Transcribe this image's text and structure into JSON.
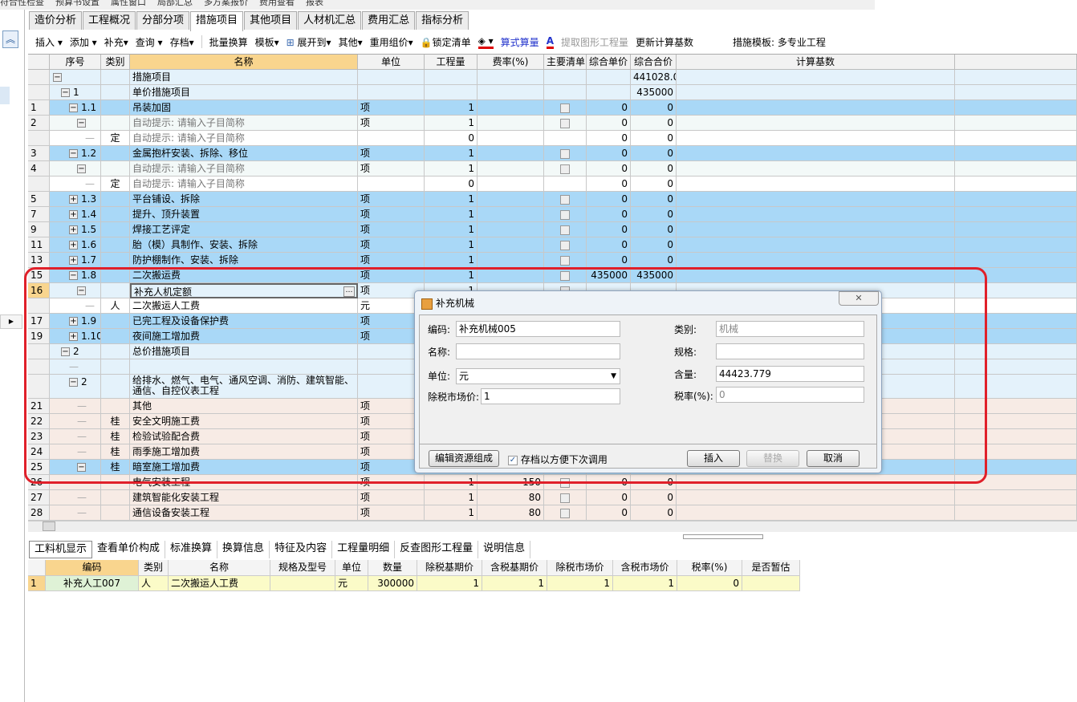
{
  "toolbar_top": [
    "符合性检查",
    "预算书设置",
    "属性窗口",
    "局部汇总",
    "多方案报价",
    "费用查看",
    "报表"
  ],
  "tabs": [
    "造价分析",
    "工程概况",
    "分部分项",
    "措施项目",
    "其他项目",
    "人材机汇总",
    "费用汇总",
    "指标分析"
  ],
  "active_tab": "措施项目",
  "toolbar": {
    "insert": "插入 ▾",
    "add": "添加 ▾",
    "supplement": "补充▾",
    "query": "查询 ▾",
    "archive": "存档▾",
    "batch": "批量换算",
    "template": "模板▾",
    "expand": "展开到▾",
    "other": "其他▾",
    "reuse": "重用组价▾",
    "lock": "锁定清单",
    "formula": "算式算量",
    "extract": "提取图形工程量",
    "update": "更新计算基数",
    "measure_template": "措施模板: 多专业工程"
  },
  "grid": {
    "headers": [
      "",
      "序号",
      "类别",
      "名称",
      "单位",
      "工程量",
      "费率(%)",
      "主要清单",
      "综合单价",
      "综合合价",
      "计算基数",
      ""
    ],
    "rows": [
      {
        "n": "",
        "seq": "措施",
        "t": "",
        "name": "措施项目",
        "unit": "",
        "qty": "",
        "rate": "",
        "main": false,
        "up": "",
        "tp": "441028.09",
        "style": "light",
        "tog": "−",
        "lvl": 0
      },
      {
        "n": "",
        "seq": "1",
        "t": "",
        "name": "单价措施项目",
        "unit": "",
        "qty": "",
        "rate": "",
        "main": false,
        "up": "",
        "tp": "435000",
        "style": "light",
        "tog": "−",
        "lvl": 1
      },
      {
        "n": "1",
        "seq": "1.1",
        "t": "",
        "name": "吊装加固",
        "unit": "项",
        "qty": "1",
        "rate": "",
        "main": true,
        "up": "0",
        "tp": "0",
        "style": "blue",
        "tog": "−",
        "lvl": 2
      },
      {
        "n": "2",
        "seq": "",
        "t": "",
        "name": "自动提示: 请输入子目简称",
        "unit": "项",
        "qty": "1",
        "rate": "",
        "main": true,
        "up": "0",
        "tp": "0",
        "style": "hint",
        "tog": "−",
        "lvl": 3
      },
      {
        "n": "",
        "seq": "",
        "t": "定",
        "name": "自动提示: 请输入子目简称",
        "unit": "",
        "qty": "0",
        "rate": "",
        "main": false,
        "up": "0",
        "tp": "0",
        "style": "white",
        "tog": "",
        "lvl": 4
      },
      {
        "n": "3",
        "seq": "1.2",
        "t": "",
        "name": "金属抱杆安装、拆除、移位",
        "unit": "项",
        "qty": "1",
        "rate": "",
        "main": true,
        "up": "0",
        "tp": "0",
        "style": "blue",
        "tog": "−",
        "lvl": 2
      },
      {
        "n": "4",
        "seq": "",
        "t": "",
        "name": "自动提示: 请输入子目简称",
        "unit": "项",
        "qty": "1",
        "rate": "",
        "main": true,
        "up": "0",
        "tp": "0",
        "style": "hint",
        "tog": "−",
        "lvl": 3
      },
      {
        "n": "",
        "seq": "",
        "t": "定",
        "name": "自动提示: 请输入子目简称",
        "unit": "",
        "qty": "0",
        "rate": "",
        "main": false,
        "up": "0",
        "tp": "0",
        "style": "white",
        "tog": "",
        "lvl": 4
      },
      {
        "n": "5",
        "seq": "1.3",
        "t": "",
        "name": "平台铺设、拆除",
        "unit": "项",
        "qty": "1",
        "rate": "",
        "main": true,
        "up": "0",
        "tp": "0",
        "style": "blue",
        "tog": "+",
        "lvl": 2
      },
      {
        "n": "7",
        "seq": "1.4",
        "t": "",
        "name": "提升、顶升装置",
        "unit": "项",
        "qty": "1",
        "rate": "",
        "main": true,
        "up": "0",
        "tp": "0",
        "style": "blue",
        "tog": "+",
        "lvl": 2
      },
      {
        "n": "9",
        "seq": "1.5",
        "t": "",
        "name": "焊接工艺评定",
        "unit": "项",
        "qty": "1",
        "rate": "",
        "main": true,
        "up": "0",
        "tp": "0",
        "style": "blue",
        "tog": "+",
        "lvl": 2
      },
      {
        "n": "11",
        "seq": "1.6",
        "t": "",
        "name": "胎（模）具制作、安装、拆除",
        "unit": "项",
        "qty": "1",
        "rate": "",
        "main": true,
        "up": "0",
        "tp": "0",
        "style": "blue",
        "tog": "+",
        "lvl": 2
      },
      {
        "n": "13",
        "seq": "1.7",
        "t": "",
        "name": "防护棚制作、安装、拆除",
        "unit": "项",
        "qty": "1",
        "rate": "",
        "main": true,
        "up": "0",
        "tp": "0",
        "style": "blue",
        "tog": "+",
        "lvl": 2
      },
      {
        "n": "15",
        "seq": "1.8",
        "t": "",
        "name": "二次搬运费",
        "unit": "项",
        "qty": "1",
        "rate": "",
        "main": true,
        "up": "435000",
        "tp": "435000",
        "style": "blue",
        "tog": "−",
        "lvl": 2
      },
      {
        "n": "16",
        "seq": "",
        "t": "",
        "name": "补充人机定额",
        "unit": "项",
        "qty": "1",
        "rate": "",
        "main": true,
        "up": "",
        "tp": "",
        "style": "light sel",
        "tog": "−",
        "lvl": 3
      },
      {
        "n": "",
        "seq": "",
        "t": "人",
        "name": "二次搬运人工费",
        "unit": "元",
        "qty": "",
        "rate": "",
        "main": false,
        "up": "",
        "tp": "",
        "style": "white",
        "tog": "",
        "lvl": 4
      },
      {
        "n": "17",
        "seq": "1.9",
        "t": "",
        "name": "已完工程及设备保护费",
        "unit": "项",
        "qty": "",
        "rate": "",
        "main": false,
        "up": "",
        "tp": "",
        "style": "blue",
        "tog": "+",
        "lvl": 2
      },
      {
        "n": "19",
        "seq": "1.10",
        "t": "",
        "name": "夜间施工增加费",
        "unit": "项",
        "qty": "",
        "rate": "",
        "main": false,
        "up": "",
        "tp": "",
        "style": "blue",
        "tog": "+",
        "lvl": 2
      },
      {
        "n": "",
        "seq": "2",
        "t": "",
        "name": "总价措施项目",
        "unit": "",
        "qty": "",
        "rate": "",
        "main": false,
        "up": "",
        "tp": "",
        "style": "light",
        "tog": "−",
        "lvl": 1
      },
      {
        "n": "",
        "seq": "",
        "t": "",
        "name": "",
        "unit": "",
        "qty": "",
        "rate": "",
        "main": false,
        "up": "",
        "tp": "",
        "style": "light",
        "tog": "",
        "lvl": 2
      },
      {
        "n": "",
        "seq": "2",
        "t": "",
        "name": "给排水、燃气、电气、通风空调、消防、建筑智能、通信、自控仪表工程",
        "unit": "",
        "qty": "",
        "rate": "",
        "main": false,
        "up": "",
        "tp": "",
        "style": "light tall",
        "tog": "−",
        "lvl": 2
      },
      {
        "n": "21",
        "seq": "",
        "t": "",
        "name": "其他",
        "unit": "项",
        "qty": "",
        "rate": "",
        "main": false,
        "up": "",
        "tp": "",
        "style": "peach",
        "tog": "",
        "lvl": 3
      },
      {
        "n": "22",
        "seq": "",
        "t": "桂",
        "name": "安全文明施工费",
        "unit": "项",
        "qty": "",
        "rate": "",
        "main": false,
        "up": "",
        "tp": "",
        "style": "peach",
        "tog": "",
        "lvl": 3
      },
      {
        "n": "23",
        "seq": "",
        "t": "桂",
        "name": "检验试验配合费",
        "unit": "项",
        "qty": "",
        "rate": "",
        "main": false,
        "up": "",
        "tp": "",
        "style": "peach",
        "tog": "",
        "lvl": 3
      },
      {
        "n": "24",
        "seq": "",
        "t": "桂",
        "name": "雨季施工增加费",
        "unit": "项",
        "qty": "",
        "rate": "",
        "main": false,
        "up": "",
        "tp": "",
        "style": "peach",
        "tog": "",
        "lvl": 3
      },
      {
        "n": "25",
        "seq": "",
        "t": "桂",
        "name": "暗室施工增加费",
        "unit": "项",
        "qty": "",
        "rate": "",
        "main": false,
        "up": "",
        "tp": "",
        "style": "blue",
        "tog": "−",
        "lvl": 3
      },
      {
        "n": "26",
        "seq": "",
        "t": "",
        "name": "电气安装工程",
        "unit": "项",
        "qty": "1",
        "rate": "150",
        "main": true,
        "up": "0",
        "tp": "0",
        "style": "peach",
        "tog": "",
        "lvl": 3
      },
      {
        "n": "27",
        "seq": "",
        "t": "",
        "name": "建筑智能化安装工程",
        "unit": "项",
        "qty": "1",
        "rate": "80",
        "main": true,
        "up": "0",
        "tp": "0",
        "style": "peach",
        "tog": "",
        "lvl": 3
      },
      {
        "n": "28",
        "seq": "",
        "t": "",
        "name": "通信设备安装工程",
        "unit": "项",
        "qty": "1",
        "rate": "80",
        "main": true,
        "up": "0",
        "tp": "0",
        "style": "peach",
        "tog": "",
        "lvl": 3
      }
    ]
  },
  "bottom_tabs": [
    "工料机显示",
    "查看单价构成",
    "标准换算",
    "换算信息",
    "特征及内容",
    "工程量明细",
    "反查图形工程量",
    "说明信息"
  ],
  "bottom_grid": {
    "headers": [
      "",
      "编码",
      "类别",
      "名称",
      "规格及型号",
      "单位",
      "数量",
      "除税基期价",
      "含税基期价",
      "除税市场价",
      "含税市场价",
      "税率(%)",
      "是否暂估"
    ],
    "row": [
      "1",
      "补充人工007",
      "人",
      "二次搬运人工费",
      "",
      "元",
      "300000",
      "1",
      "1",
      "1",
      "1",
      "0",
      ""
    ]
  },
  "dialog": {
    "title": "补充机械",
    "close": "✕",
    "code_label": "编码:",
    "code": "补充机械005",
    "name_label": "名称:",
    "name": "",
    "unit_label": "单位:",
    "unit": "元",
    "price_label": "除税市场价:",
    "price": "1",
    "type_label": "类别:",
    "type": "机械",
    "spec_label": "规格:",
    "spec": "",
    "content_label": "含量:",
    "content": "44423.779",
    "tax_label": "税率(%):",
    "tax": "0",
    "edit_btn": "编辑资源组成",
    "save_check": "存档以方便下次调用",
    "save_checked": true,
    "insert_btn": "插入",
    "replace_btn": "替换",
    "cancel_btn": "取消"
  }
}
